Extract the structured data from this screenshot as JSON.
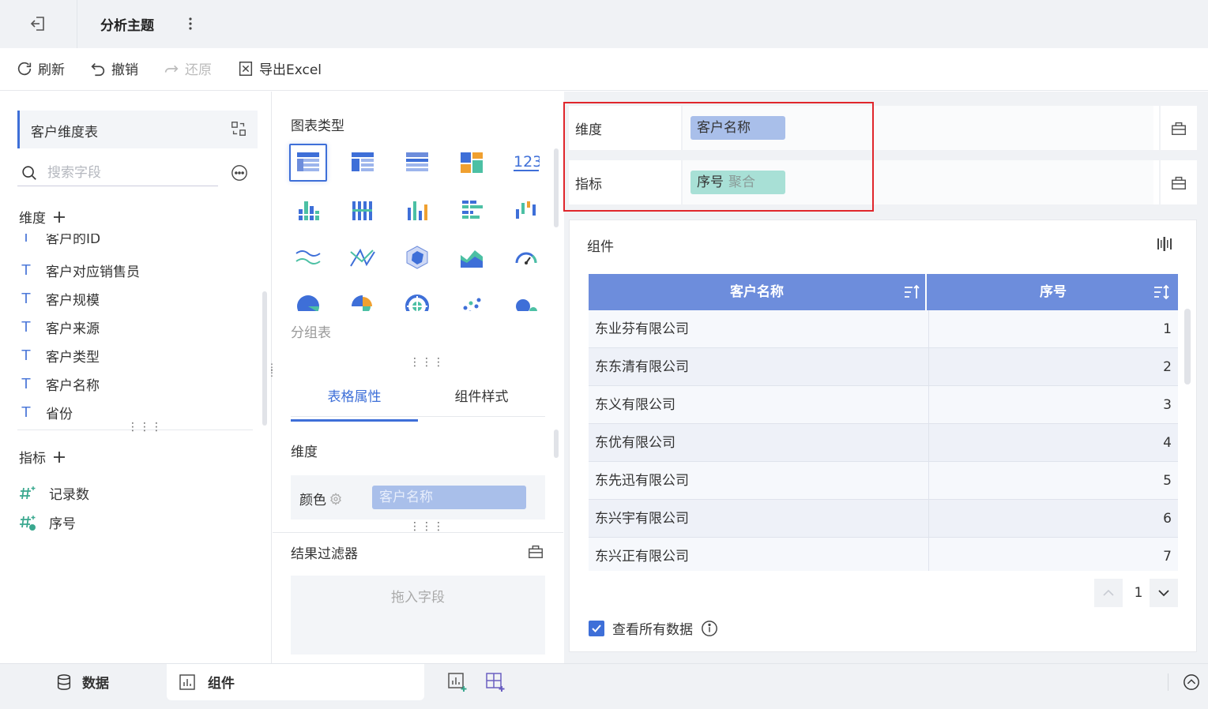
{
  "header": {
    "title": "分析主题"
  },
  "toolbar": {
    "refresh": "刷新",
    "undo": "撤销",
    "redo": "还原",
    "export": "导出Excel"
  },
  "data_panel": {
    "table_name": "客户维度表",
    "search_placeholder": "搜索字段",
    "dimension_title": "维度",
    "dimensions": [
      "客户的ID",
      "客户对应销售员",
      "客户规模",
      "客户来源",
      "客户类型",
      "客户名称",
      "省份"
    ],
    "measure_title": "指标",
    "measures": [
      "记录数",
      "序号"
    ]
  },
  "chart_panel": {
    "title": "图表类型",
    "selected_tip": "分组表",
    "tabs": [
      "表格属性",
      "组件样式"
    ],
    "props_dim_label": "维度",
    "color_label": "颜色",
    "color_field": "客户名称",
    "filter_title": "结果过滤器",
    "filter_placeholder": "拖入字段"
  },
  "shelf": {
    "dimension_label": "维度",
    "dimension_field": "客户名称",
    "measure_label": "指标",
    "measure_field": "序号",
    "measure_agg": "聚合"
  },
  "component": {
    "title": "组件",
    "columns": [
      "客户名称",
      "序号"
    ],
    "rows": [
      [
        "东业芬有限公司",
        "1"
      ],
      [
        "东东清有限公司",
        "2"
      ],
      [
        "东义有限公司",
        "3"
      ],
      [
        "东优有限公司",
        "4"
      ],
      [
        "东先迅有限公司",
        "5"
      ],
      [
        "东兴宇有限公司",
        "6"
      ],
      [
        "东兴正有限公司",
        "7"
      ]
    ],
    "page": "1",
    "view_all": "查看所有数据"
  },
  "bottom_tabs": {
    "data": "数据",
    "component": "组件"
  },
  "colors": {
    "accent": "#3e6fd8",
    "table_header": "#6d8ddc",
    "dim_pill": "#a9bfea",
    "measure_pill": "#a8e0d6",
    "highlight": "#e0262c"
  }
}
